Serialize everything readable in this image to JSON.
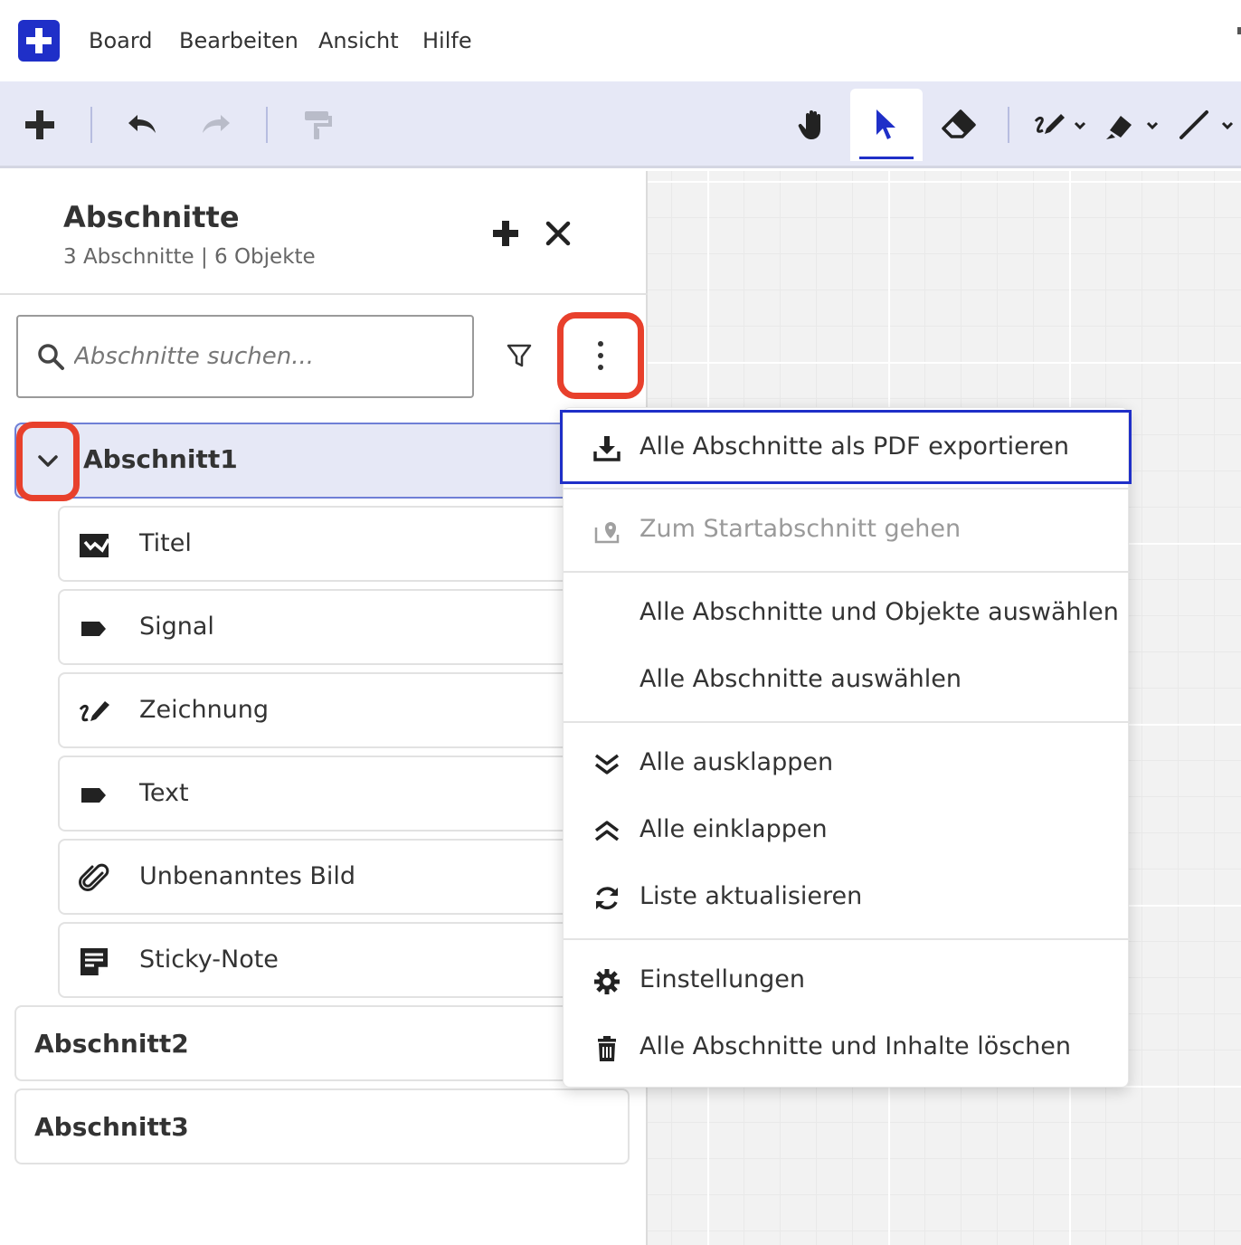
{
  "menubar": {
    "items": [
      "Board",
      "Bearbeiten",
      "Ansicht",
      "Hilfe"
    ]
  },
  "toolbar": {
    "tools": [
      "add-icon",
      "undo-icon",
      "redo-icon",
      "format-painter-icon",
      "hand-icon",
      "select-pointer-icon",
      "eraser-icon",
      "pen-icon",
      "highlighter-icon",
      "line-icon"
    ],
    "active_tool": "select-pointer-icon",
    "accent_color": "#1f2fc8"
  },
  "panel": {
    "title": "Abschnitte",
    "subtitle": "3 Abschnitte | 6 Objekte",
    "search_placeholder": "Abschnitte suchen..."
  },
  "sections": [
    {
      "label": "Abschnitt1",
      "expanded": true,
      "objects": [
        {
          "label": "Titel",
          "icon": "title-card-icon"
        },
        {
          "label": "Signal",
          "icon": "label-tag-icon"
        },
        {
          "label": "Zeichnung",
          "icon": "drawing-pen-icon"
        },
        {
          "label": "Text",
          "icon": "label-tag-icon"
        },
        {
          "label": "Unbenanntes Bild",
          "icon": "paperclip-icon"
        },
        {
          "label": "Sticky-Note",
          "icon": "sticky-note-icon"
        }
      ]
    },
    {
      "label": "Abschnitt2",
      "expanded": false
    },
    {
      "label": "Abschnitt3",
      "expanded": false
    }
  ],
  "context_menu": {
    "items": [
      {
        "label": "Alle Abschnitte als PDF exportieren",
        "icon": "download-icon",
        "focused": true
      },
      {
        "label": "Zum Startabschnitt gehen",
        "icon": "start-location-icon",
        "disabled": true
      },
      {
        "label": "Alle Abschnitte und Objekte auswählen",
        "icon": ""
      },
      {
        "label": "Alle Abschnitte auswählen",
        "icon": ""
      },
      {
        "label": "Alle ausklappen",
        "icon": "expand-all-icon"
      },
      {
        "label": "Alle einklappen",
        "icon": "collapse-all-icon"
      },
      {
        "label": "Liste aktualisieren",
        "icon": "refresh-icon"
      },
      {
        "label": "Einstellungen",
        "icon": "gear-icon"
      },
      {
        "label": "Alle Abschnitte und Inhalte löschen",
        "icon": "trash-icon"
      }
    ]
  },
  "highlight_color": "#e8402c"
}
